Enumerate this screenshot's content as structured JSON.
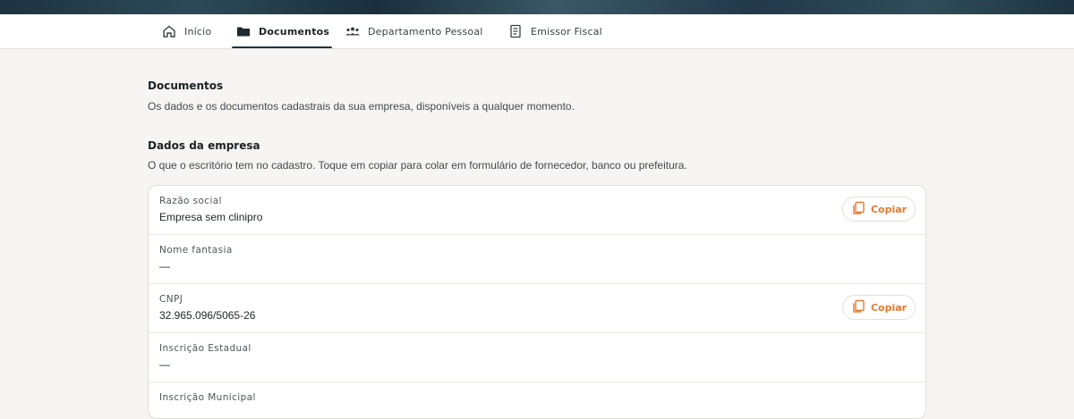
{
  "nav": {
    "items": [
      {
        "label": "Início",
        "icon": "home-icon"
      },
      {
        "label": "Documentos",
        "icon": "folder-icon",
        "active": true
      },
      {
        "label": "Departamento Pessoal",
        "icon": "people-icon"
      },
      {
        "label": "Emissor Fiscal",
        "icon": "receipt-icon"
      }
    ]
  },
  "documents": {
    "title": "Documentos",
    "description": "Os dados e os documentos cadastrais da sua empresa, disponíveis a qualquer momento."
  },
  "company": {
    "title": "Dados da empresa",
    "description": "O que o escritório tem no cadastro. Toque em copiar para colar em formulário de fornecedor, banco ou prefeitura.",
    "rows": [
      {
        "label": "Razão social",
        "value": "Empresa sem clinipro",
        "copy": "Copiar"
      },
      {
        "label": "Nome fantasia",
        "value": "—"
      },
      {
        "label": "CNPJ",
        "value": "32.965.096/5065-26",
        "copy": "Copiar"
      },
      {
        "label": "Inscrição Estadual",
        "value": "—"
      },
      {
        "label": "Inscrição Municipal",
        "value": ""
      }
    ]
  },
  "colors": {
    "accent": "#e07a2e",
    "nav_active": "#1e3441",
    "background": "#f6f5f3"
  }
}
